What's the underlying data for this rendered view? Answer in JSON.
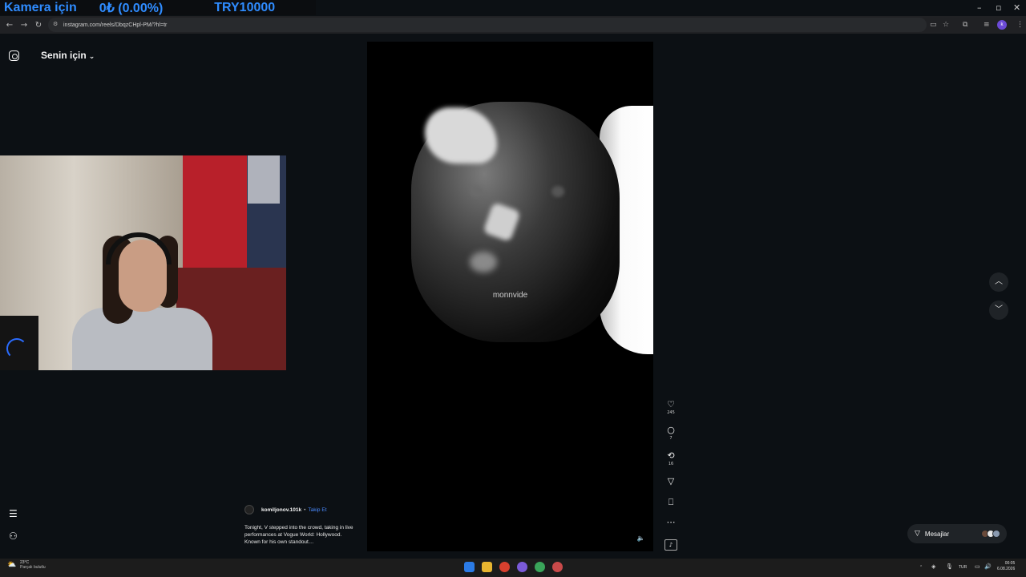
{
  "stream_overlay": {
    "label": "Kamera için",
    "amount": "0₺ (0.00%)",
    "goal": "TRY10000"
  },
  "window_controls": {
    "minimize": "–",
    "restore": "▫",
    "close": "✕"
  },
  "browser": {
    "url": "instagram.com/reels/DbqzCHpl-PM/?hl=tr",
    "back": "←",
    "forward": "→",
    "reload": "↻"
  },
  "instagram": {
    "feed_selector": "Senin için",
    "reel": {
      "watermark": "monnvide",
      "author": "komiljonov.101k",
      "separator": "•",
      "follow": "Takip Et",
      "caption": "Tonight, V stepped into the crowd, taking in live performances at Vogue World: Hollywood. Known for his own standout…"
    },
    "actions": {
      "like_count": "245",
      "comment_count": "7",
      "repost_count": "16"
    },
    "messages_label": "Mesajlar"
  },
  "taskbar": {
    "temperature": "23°C",
    "weather": "Parçalı bulutlu",
    "language": "TUR",
    "time": "00:05",
    "date": "6.08.2026"
  },
  "colors": {
    "accent_blue": "#2f8cff",
    "follow_blue": "#4a8bff",
    "page_bg": "#0c1014"
  }
}
